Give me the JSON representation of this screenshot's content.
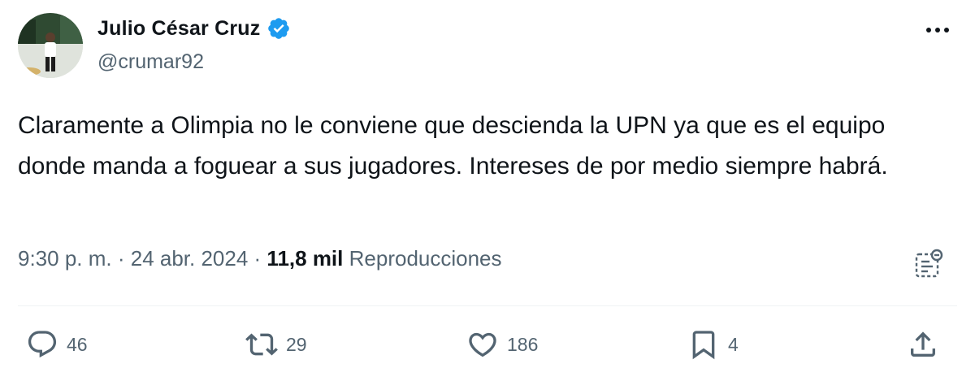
{
  "author": {
    "display_name": "Julio César Cruz",
    "handle": "@crumar92",
    "verified": true
  },
  "tweet": {
    "text": "Claramente a Olimpia no le conviene que descienda la UPN ya que es el equipo donde manda a foguear a sus jugadores. Intereses de por medio siempre habrá.",
    "time": "9:30 p. m.",
    "separator": " · ",
    "date": "24 abr. 2024",
    "views_count": "11,8 mil",
    "views_label": "Reproducciones"
  },
  "actions": {
    "replies": "46",
    "retweets": "29",
    "likes": "186",
    "bookmarks": "4"
  },
  "icons": {
    "more": "more-dots-icon",
    "verified": "verified-badge-icon",
    "analytics": "analytics-icon",
    "reply": "reply-icon",
    "retweet": "retweet-icon",
    "like": "heart-icon",
    "bookmark": "bookmark-icon",
    "share": "share-icon"
  },
  "colors": {
    "text_primary": "#0f1419",
    "text_secondary": "#536471",
    "verified_blue": "#1d9bf0"
  }
}
